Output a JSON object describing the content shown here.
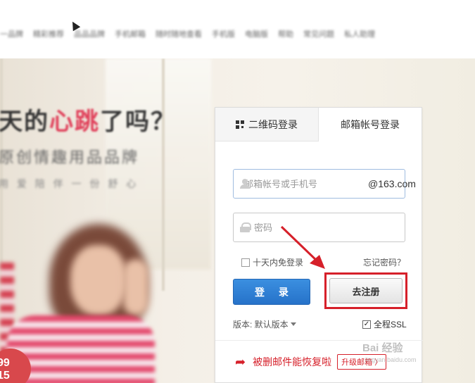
{
  "topnav": {
    "items": [
      "一品牌",
      "精彩推荐",
      "品品品牌",
      "手机邮箱",
      "随时随地查看",
      "手机版",
      "电脑版",
      "帮助",
      "常见问题",
      "私人助理"
    ]
  },
  "hero": {
    "slogan1_a": "天的",
    "slogan1_red": "心跳",
    "slogan1_b": "了吗？",
    "slogan2": "原创情趣用品品牌",
    "slogan3": "用 爱 陪 伴 一 份 舒 心",
    "price_badge": "99\n15"
  },
  "login": {
    "tabs": {
      "qr": "二维码登录",
      "account": "邮箱帐号登录"
    },
    "username_placeholder": "邮箱帐号或手机号",
    "domain_suffix": "@163.com",
    "password_placeholder": "密码",
    "remember_label": "十天内免登录",
    "forgot_label": "忘记密码？",
    "login_button": "登 录",
    "register_button": "去注册",
    "version_label": "版本: 默认版本",
    "ssl_label": "全程SSL",
    "promo_text": "被删邮件能恢复啦",
    "upgrade_label": "升级邮箱 〉"
  },
  "colors": {
    "primary_blue": "#2672c9",
    "highlight_red": "#d6202a",
    "accent_pink": "#e0405a"
  },
  "watermark": {
    "brand": "Bai 经验",
    "url": "jingyan.baidu.com"
  }
}
